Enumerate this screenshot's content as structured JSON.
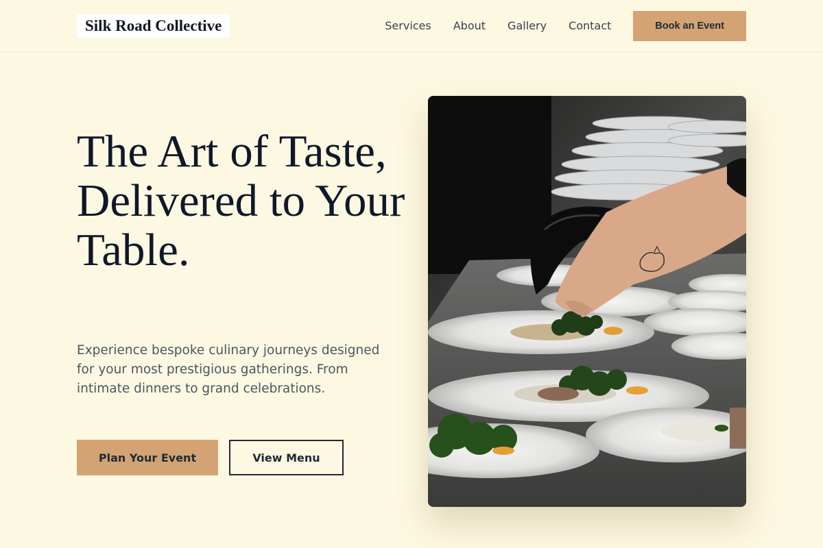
{
  "brand": {
    "name": "Silk Road Collective"
  },
  "nav": {
    "links": [
      "Services",
      "About",
      "Gallery",
      "Contact"
    ],
    "cta": "Book an Event"
  },
  "hero": {
    "title": "The Art of Taste, Delivered to Your Table.",
    "subtitle": "Experience bespoke culinary journeys designed for your most prestigious gatherings. From intimate dinners to grand celebrations.",
    "primary_button": "Plan Your Event",
    "secondary_button": "View Menu",
    "image_icon": "plated-dishes-photo"
  },
  "colors": {
    "background": "#fdf8e1",
    "accent": "#d4a373",
    "text_dark": "#0f172a",
    "text_muted": "#4b5563"
  }
}
